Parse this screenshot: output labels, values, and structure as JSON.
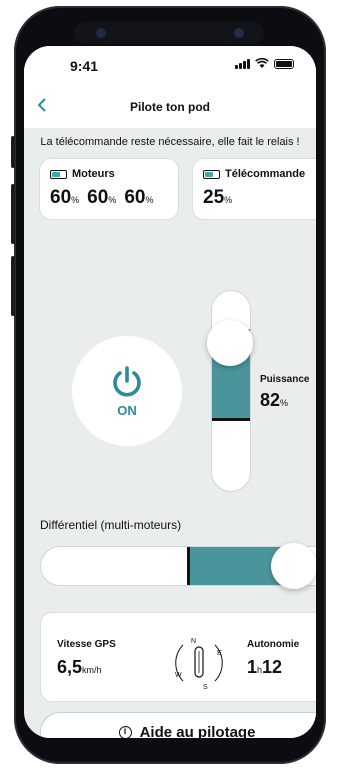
{
  "status": {
    "time": "9:41"
  },
  "nav": {
    "title": "Pilote ton pod"
  },
  "notice": "La télécommande reste nécessaire, elle fait le relais !",
  "motors": {
    "title": "Moteurs",
    "values": [
      "60",
      "60",
      "60"
    ],
    "unit": "%"
  },
  "remote": {
    "title": "Télécommande",
    "value": "25",
    "unit": "%"
  },
  "power": {
    "label": "ON"
  },
  "puissance": {
    "label": "Puissance",
    "value": "82",
    "unit": "%"
  },
  "differentiel": {
    "label": "Différentiel (multi-moteurs)"
  },
  "gps": {
    "speed_label": "Vitesse GPS",
    "speed_value": "6,5",
    "speed_unit": "km/h",
    "autonomy_label": "Autonomie",
    "autonomy_hours": "1",
    "autonomy_h": "h",
    "autonomy_min": "12",
    "compass": {
      "n": "N",
      "e": "E",
      "s": "S",
      "w": "W"
    }
  },
  "help": {
    "label": "Aide au pilotage"
  },
  "colors": {
    "accent": "#2e8a9a",
    "fill": "#4a959b",
    "screen_bg": "#e9eeed"
  },
  "icons": [
    "back-chevron-icon",
    "battery-icon",
    "power-icon",
    "compass-icon",
    "info-icon"
  ]
}
